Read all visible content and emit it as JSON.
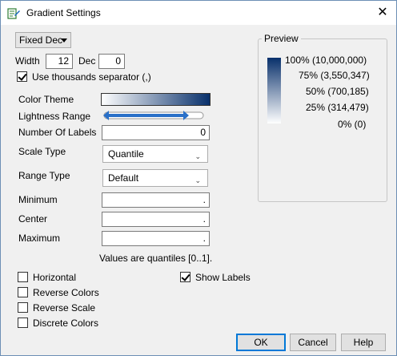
{
  "window": {
    "title": "Gradient Settings",
    "close_symbol": "✕"
  },
  "format": {
    "selected": "Fixed Dec"
  },
  "width": {
    "label": "Width",
    "value": "12"
  },
  "dec": {
    "label": "Dec",
    "value": "0"
  },
  "thousands": {
    "label": "Use thousands separator (,)",
    "checked": true
  },
  "color_theme": {
    "label": "Color Theme",
    "colors": [
      "#ffffff",
      "#08306b"
    ]
  },
  "lightness_range": {
    "label": "Lightness Range",
    "fill_start": 0.0,
    "fill_end": 0.8
  },
  "number_of_labels": {
    "label": "Number Of Labels",
    "value": "0"
  },
  "scale_type": {
    "label": "Scale Type",
    "selected": "Quantile"
  },
  "range_type": {
    "label": "Range Type",
    "selected": "Default"
  },
  "minimum": {
    "label": "Minimum",
    "value": "."
  },
  "center": {
    "label": "Center",
    "value": "."
  },
  "maximum": {
    "label": "Maximum",
    "value": "."
  },
  "note": "Values are quantiles [0..1].",
  "preview": {
    "legend": "Preview",
    "labels": [
      "100% (10,000,000)",
      "75% (3,550,347)",
      "50% (700,185)",
      "25% (314,479)",
      "0% (0)"
    ]
  },
  "options": {
    "horizontal": {
      "label": "Horizontal",
      "checked": false
    },
    "reverse_colors": {
      "label": "Reverse Colors",
      "checked": false
    },
    "reverse_scale": {
      "label": "Reverse Scale",
      "checked": false
    },
    "discrete_colors": {
      "label": "Discrete Colors",
      "checked": false
    },
    "show_labels": {
      "label": "Show Labels",
      "checked": true
    }
  },
  "buttons": {
    "ok": "OK",
    "cancel": "Cancel",
    "help": "Help"
  },
  "colors": {
    "accent": "#0078d7",
    "gradient_dark": "#08306b",
    "slider_blue": "#2a70c8"
  }
}
